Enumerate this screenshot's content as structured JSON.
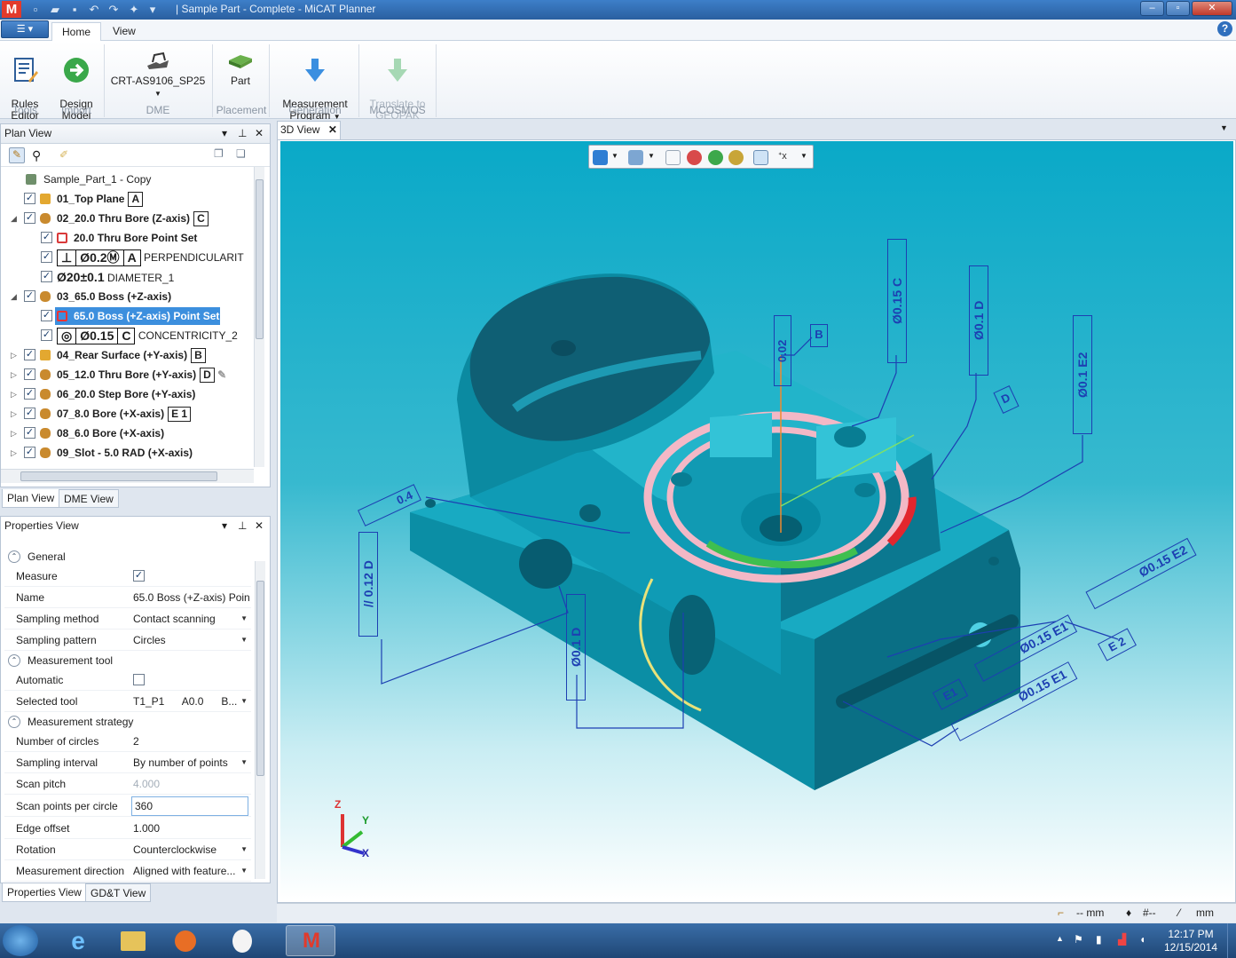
{
  "window": {
    "title": "| Sample Part - Complete - MiCAT Planner",
    "app_icon": "M"
  },
  "ribbon": {
    "tabs": [
      "Home",
      "View"
    ],
    "active_tab": "Home",
    "buttons": {
      "rules_editor": "Rules\nEditor",
      "design_model": "Design\nModel",
      "dme": "CRT-AS9106_SP25",
      "part": "Part",
      "measurement_program": "Measurement\nProgram",
      "translate": "Translate to\nGEOPAK"
    },
    "groups": {
      "tools": "Tools",
      "import": "Import",
      "dme": "DME",
      "placement": "Placement",
      "generation": "Generation",
      "mcosmos": "MCOSMOS"
    }
  },
  "plan_view": {
    "title": "Plan View",
    "root": "Sample_Part_1 - Copy",
    "items": [
      {
        "label": "01_Top Plane",
        "datum": "A"
      },
      {
        "label": "02_20.0 Thru Bore (Z-axis)",
        "datum": "C"
      },
      {
        "label": "20.0 Thru Bore Point Set"
      },
      {
        "label": "PERPENDICULARIT",
        "gdt": [
          "⊥",
          "Ø0.2Ⓜ",
          "A"
        ]
      },
      {
        "label": "DIAMETER_1",
        "gdt_text": "Ø20±0.1"
      },
      {
        "label": "03_65.0 Boss (+Z-axis)"
      },
      {
        "label": "65.0 Boss (+Z-axis) Point Set"
      },
      {
        "label": "CONCENTRICITY_2",
        "gdt": [
          "◎",
          "Ø0.15",
          "C"
        ]
      },
      {
        "label": "04_Rear Surface (+Y-axis)",
        "datum": "B"
      },
      {
        "label": "05_12.0 Thru Bore (+Y-axis)",
        "datum": "D"
      },
      {
        "label": "06_20.0 Step Bore (+Y-axis)"
      },
      {
        "label": "07_8.0 Bore (+X-axis)",
        "datum": "E 1"
      },
      {
        "label": "08_6.0 Bore (+X-axis)"
      },
      {
        "label": "09_Slot - 5.0 RAD (+X-axis)"
      }
    ],
    "bottom_tabs": [
      "Plan View",
      "DME View"
    ]
  },
  "properties_view": {
    "title": "Properties View",
    "sections": {
      "general": "General",
      "measurement_tool": "Measurement tool",
      "measurement_strategy": "Measurement strategy"
    },
    "rows": {
      "measure": {
        "label": "Measure",
        "value": "✓"
      },
      "name": {
        "label": "Name",
        "value": "65.0 Boss (+Z-axis) Poin"
      },
      "sampling_method": {
        "label": "Sampling method",
        "value": "Contact scanning"
      },
      "sampling_pattern": {
        "label": "Sampling pattern",
        "value": "Circles"
      },
      "automatic": {
        "label": "Automatic",
        "value": ""
      },
      "selected_tool": {
        "label": "Selected tool",
        "value": "T1_P1      A0.0      B..."
      },
      "number_of_circles": {
        "label": "Number of circles",
        "value": "2"
      },
      "sampling_interval": {
        "label": "Sampling interval",
        "value": "By number of points"
      },
      "scan_pitch": {
        "label": "Scan pitch",
        "value": "4.000"
      },
      "scan_points": {
        "label": "Scan points per circle",
        "value": "360"
      },
      "edge_offset": {
        "label": "Edge offset",
        "value": "1.000"
      },
      "rotation": {
        "label": "Rotation",
        "value": "Counterclockwise"
      },
      "measurement_direction": {
        "label": "Measurement direction",
        "value": "Aligned with feature..."
      }
    },
    "bottom_tabs": [
      "Properties View",
      "GD&T View"
    ]
  },
  "view3d": {
    "tab": "3D View",
    "axes": {
      "x": "X",
      "y": "Y",
      "z": "Z"
    },
    "annotations": {
      "fcf_left": "Ø0.1 D",
      "fcf_para": "// 0.12 D",
      "fcf_top1": "Ø0.15 C",
      "fcf_top2": "Ø0.1 D",
      "fcf_top3": "Ø0.1 E2",
      "fcf_b": "0.02",
      "fcf_04": "0.4",
      "datum_b": "B",
      "datum_d": "D",
      "datum_e1": "E1",
      "datum_e2": "E 2",
      "fcf_e2": "Ø0.15 E2",
      "fcf_e1": "Ø0.15 E1",
      "fcf_mid": "Ø0.15 E1"
    }
  },
  "status": {
    "unit1": "-- mm",
    "unit2": "#--",
    "unit3": "mm"
  },
  "taskbar": {
    "time": "12:17 PM",
    "date": "12/15/2014"
  }
}
